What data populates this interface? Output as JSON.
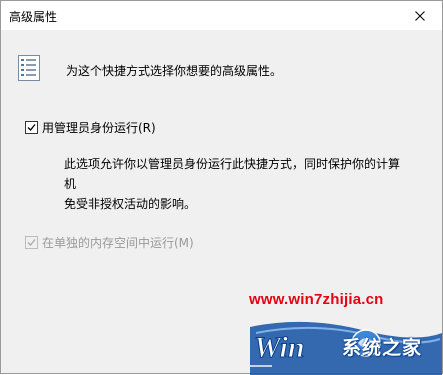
{
  "window": {
    "title": "高级属性"
  },
  "header": {
    "text": "为这个快捷方式选择你想要的高级属性。"
  },
  "admin_option": {
    "label": "用管理员身份运行(R)",
    "checked": true,
    "description_line1": "此选项允许你以管理员身份运行此快捷方式，同时保护你的计算机",
    "description_line2": "免受非授权活动的影响。"
  },
  "memory_option": {
    "label": "在单独的内存空间中运行(M)",
    "checked": true,
    "enabled": false
  },
  "watermark": {
    "url": "www.win7zhijia.cn",
    "brand": "系统之家",
    "logo_word": "Win"
  },
  "icons": {
    "header": "properties-list-icon",
    "close": "close-icon",
    "check": "check-icon"
  }
}
